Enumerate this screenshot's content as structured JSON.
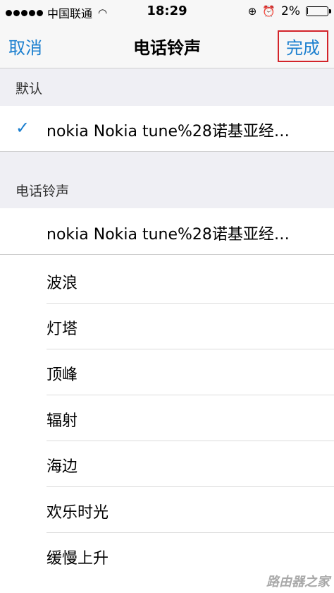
{
  "status": {
    "carrier": "中国联通",
    "time": "18:29",
    "battery": "2%",
    "battery_level": 0.02
  },
  "nav": {
    "cancel": "取消",
    "title": "电话铃声",
    "done": "完成"
  },
  "sections": {
    "default_header": "默认",
    "ringtone_header": "电话铃声"
  },
  "default_item": {
    "check": "✓",
    "label": "nokia Nokia tune%28诺基亚经…"
  },
  "ringtones": [
    "nokia Nokia tune%28诺基亚经…",
    "波浪",
    "灯塔",
    "顶峰",
    "辐射",
    "海边",
    "欢乐时光",
    "缓慢上升"
  ],
  "watermark": "路由器之家"
}
